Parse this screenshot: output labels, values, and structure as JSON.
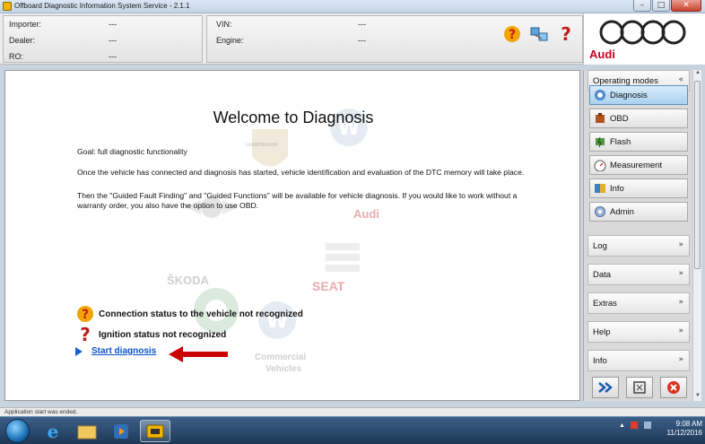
{
  "window": {
    "title": "Offboard Diagnostic Information System Service - 2.1.1",
    "controls": [
      "–",
      "□",
      "✕"
    ]
  },
  "header": {
    "left": [
      {
        "label": "Importer:",
        "value": "---"
      },
      {
        "label": "Dealer:",
        "value": "---"
      },
      {
        "label": "RO:",
        "value": "---"
      }
    ],
    "right": [
      {
        "label": "VIN:",
        "value": "---"
      },
      {
        "label": "Engine:",
        "value": "---"
      }
    ],
    "icons": [
      "help-question-icon",
      "network-computer-icon",
      "help-info-icon"
    ]
  },
  "brand": {
    "name": "Audi",
    "color": "#c8001e"
  },
  "main": {
    "title": "Welcome to Diagnosis",
    "goal": "Goal: full diagnostic functionality",
    "para1": "Once the vehicle has connected and diagnosis has started, vehicle identification and evaluation of the DTC memory will take place.",
    "para2": "Then the \"Guided Fault Finding\" and \"Guided Functions\" will be available for vehicle diagnosis. If you would like to work without a warranty order, you also have the option to use OBD.",
    "status_connection": "Connection status to the vehicle not recognized",
    "status_ignition": "Ignition status not recognized",
    "start_link": "Start diagnosis",
    "watermarks": {
      "lamborghini": "LAMBORGHINI",
      "audi": "Audi",
      "skoda": "ŠKODA",
      "seat": "SEAT",
      "commercial": "Commercial",
      "vehicles": "Vehicles"
    }
  },
  "sidebar": {
    "operating_modes": "Operating modes",
    "modes": [
      {
        "label": "Diagnosis",
        "active": true,
        "icon": "stethoscope-icon"
      },
      {
        "label": "OBD",
        "active": false,
        "icon": "engine-icon"
      },
      {
        "label": "Flash",
        "active": false,
        "icon": "flash-chip-icon"
      },
      {
        "label": "Measurement",
        "active": false,
        "icon": "gauge-icon"
      },
      {
        "label": "Info",
        "active": false,
        "icon": "book-icon"
      },
      {
        "label": "Admin",
        "active": false,
        "icon": "admin-gear-icon"
      }
    ],
    "sections": [
      "Log",
      "Data",
      "Extras",
      "Help",
      "Info"
    ],
    "chevron": "»",
    "chevron_up": "«"
  },
  "statusbar": {
    "text": "Application start was ended."
  },
  "taskbar": {
    "clock_time": "9:08 AM",
    "clock_date": "11/12/2016"
  }
}
